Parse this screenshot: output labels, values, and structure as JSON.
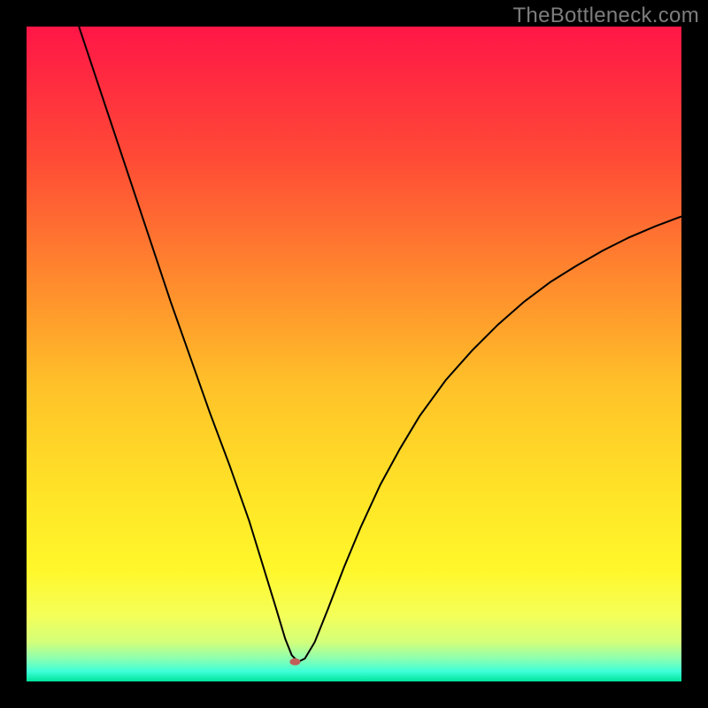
{
  "watermark": "TheBottleneck.com",
  "chart_data": {
    "type": "line",
    "title": "",
    "xlabel": "",
    "ylabel": "",
    "xlim": [
      0,
      100
    ],
    "ylim": [
      0,
      100
    ],
    "background": {
      "type": "vertical-gradient",
      "stops": [
        {
          "offset": 0.0,
          "color": "#ff1647"
        },
        {
          "offset": 0.2,
          "color": "#ff4a36"
        },
        {
          "offset": 0.4,
          "color": "#ff8e2d"
        },
        {
          "offset": 0.55,
          "color": "#ffc229"
        },
        {
          "offset": 0.72,
          "color": "#ffe527"
        },
        {
          "offset": 0.83,
          "color": "#fff72b"
        },
        {
          "offset": 0.9,
          "color": "#f4ff59"
        },
        {
          "offset": 0.94,
          "color": "#d3ff7a"
        },
        {
          "offset": 0.965,
          "color": "#8dffb0"
        },
        {
          "offset": 0.985,
          "color": "#3dffd8"
        },
        {
          "offset": 1.0,
          "color": "#00e39a"
        }
      ]
    },
    "marker": {
      "x": 41,
      "y": 3,
      "color": "#c06058",
      "rx": 6,
      "ry": 4
    },
    "series": [
      {
        "name": "curve",
        "color": "#000000",
        "width": 2,
        "points": [
          {
            "x": 8.0,
            "y": 100.0
          },
          {
            "x": 10.0,
            "y": 94.0
          },
          {
            "x": 13.0,
            "y": 85.0
          },
          {
            "x": 16.0,
            "y": 76.0
          },
          {
            "x": 19.0,
            "y": 67.0
          },
          {
            "x": 22.0,
            "y": 58.0
          },
          {
            "x": 25.0,
            "y": 49.5
          },
          {
            "x": 28.0,
            "y": 41.0
          },
          {
            "x": 31.0,
            "y": 33.0
          },
          {
            "x": 34.0,
            "y": 24.5
          },
          {
            "x": 36.0,
            "y": 18.0
          },
          {
            "x": 38.0,
            "y": 11.5
          },
          {
            "x": 39.5,
            "y": 6.5
          },
          {
            "x": 40.5,
            "y": 4.0
          },
          {
            "x": 41.5,
            "y": 3.0
          },
          {
            "x": 42.5,
            "y": 3.5
          },
          {
            "x": 44.0,
            "y": 6.0
          },
          {
            "x": 46.0,
            "y": 11.0
          },
          {
            "x": 48.5,
            "y": 17.5
          },
          {
            "x": 51.0,
            "y": 23.5
          },
          {
            "x": 54.0,
            "y": 30.0
          },
          {
            "x": 57.0,
            "y": 35.5
          },
          {
            "x": 60.0,
            "y": 40.5
          },
          {
            "x": 64.0,
            "y": 46.0
          },
          {
            "x": 68.0,
            "y": 50.5
          },
          {
            "x": 72.0,
            "y": 54.5
          },
          {
            "x": 76.0,
            "y": 58.0
          },
          {
            "x": 80.0,
            "y": 61.0
          },
          {
            "x": 84.0,
            "y": 63.5
          },
          {
            "x": 88.0,
            "y": 65.8
          },
          {
            "x": 92.0,
            "y": 67.8
          },
          {
            "x": 96.0,
            "y": 69.5
          },
          {
            "x": 100.0,
            "y": 71.0
          }
        ]
      }
    ]
  }
}
